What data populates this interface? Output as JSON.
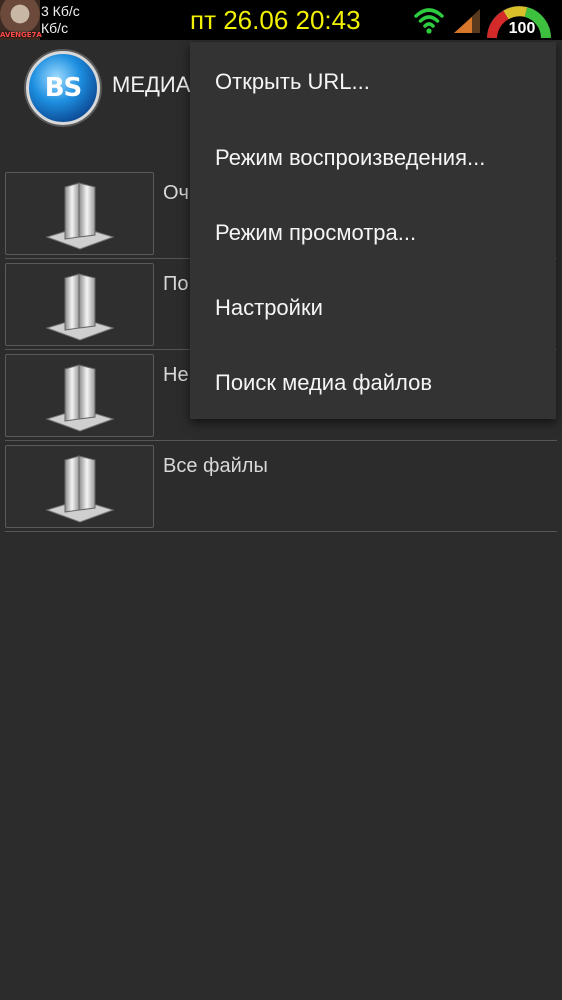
{
  "status_bar": {
    "avatar_tag": "AVENGE7A",
    "upload_rate": "3 Кб/с",
    "download_rate": "Кб/с",
    "clock": "пт 26.06 20:43",
    "battery_level": "100",
    "icons": [
      "wifi-icon",
      "cell-signal-icon",
      "battery-gauge-icon"
    ],
    "colors": {
      "clock": "#f0f000",
      "wifi": "#2ecc40",
      "signal": "#d9772a"
    }
  },
  "header": {
    "logo_text": "BS",
    "title": "МЕДИА"
  },
  "list": {
    "items": [
      {
        "label": "Оч",
        "icon": "folder-icon"
      },
      {
        "label": "По",
        "icon": "folder-icon"
      },
      {
        "label": "Не",
        "icon": "folder-icon"
      },
      {
        "label": "Все файлы",
        "icon": "folder-icon"
      }
    ]
  },
  "menu": {
    "items": [
      {
        "label": "Открыть URL..."
      },
      {
        "label": "Режим воспроизведения..."
      },
      {
        "label": "Режим просмотра..."
      },
      {
        "label": "Настройки"
      },
      {
        "label": "Поиск медиа файлов"
      }
    ]
  }
}
